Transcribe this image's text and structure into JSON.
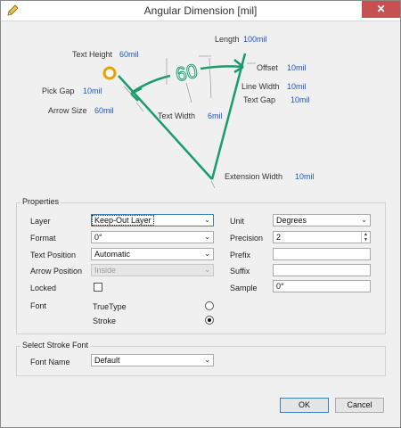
{
  "window": {
    "title": "Angular Dimension [mil]",
    "close_glyph": "✕",
    "app_icon": "pencil-icon"
  },
  "diagram": {
    "text_height": {
      "label": "Text Height",
      "value": "60mil"
    },
    "length": {
      "label": "Length",
      "value": "100mil"
    },
    "offset": {
      "label": "Offset",
      "value": "10mil"
    },
    "line_width": {
      "label": "Line Width",
      "value": "10mil"
    },
    "text_gap": {
      "label": "Text Gap",
      "value": "10mil"
    },
    "pick_gap": {
      "label": "Pick Gap",
      "value": "10mil"
    },
    "arrow_size": {
      "label": "Arrow Size",
      "value": "60mil"
    },
    "text_width": {
      "label": "Text Width",
      "value": "6mil"
    },
    "extension_width": {
      "label": "Extension Width",
      "value": "10mil"
    },
    "sample_text": "60",
    "accent": "#1a9c6b",
    "marker": "#e8a300"
  },
  "properties": {
    "title": "Properties",
    "layer": {
      "label": "Layer",
      "value": "Keep-Out Layer"
    },
    "format": {
      "label": "Format",
      "value": "0°"
    },
    "text_position": {
      "label": "Text Position",
      "value": "Automatic"
    },
    "arrow_position": {
      "label": "Arrow Position",
      "value": "Inside"
    },
    "locked": {
      "label": "Locked"
    },
    "font": {
      "label": "Font",
      "truetype": "TrueType",
      "stroke": "Stroke"
    },
    "unit": {
      "label": "Unit",
      "value": "Degrees"
    },
    "precision": {
      "label": "Precision",
      "value": "2"
    },
    "prefix": {
      "label": "Prefix",
      "value": ""
    },
    "suffix": {
      "label": "Suffix",
      "value": ""
    },
    "sample": {
      "label": "Sample",
      "value": "0°"
    }
  },
  "stroke_font": {
    "title": "Select Stroke Font",
    "font_name": {
      "label": "Font Name",
      "value": "Default"
    }
  },
  "buttons": {
    "ok": "OK",
    "cancel": "Cancel"
  },
  "glyphs": {
    "dropdown": "⌄",
    "spin_up": "▲",
    "spin_down": "▼"
  }
}
